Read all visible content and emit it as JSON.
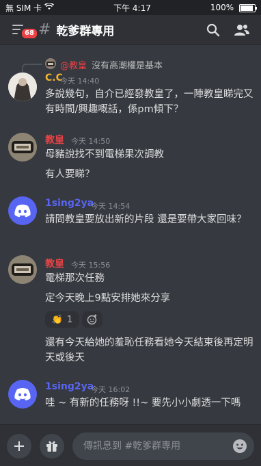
{
  "status_bar": {
    "carrier": "無 SIM 卡",
    "time": "下午 4:17",
    "battery_percent": "100%",
    "battery_level": 1.0
  },
  "header": {
    "badge_count": "68",
    "channel_name": "乾爹群專用"
  },
  "reply": {
    "mention": "@教皇",
    "text": "沒有高潮權是基本"
  },
  "messages": [
    {
      "author": "C.C",
      "author_color": "#f0b232",
      "timestamp": "今天 14:40",
      "lines": [
        "多說幾句，自介已經發教皇了，一陣教皇睇完又有時間/興趣嘅話，係pm傾下？"
      ]
    },
    {
      "author": "教皇",
      "author_color": "#ed4245",
      "timestamp": "今天 14:50",
      "lines": [
        "母豬說找不到電梯果次調教",
        "有人要睇？"
      ]
    },
    {
      "author": "1sing2ya",
      "author_color": "#5865f2",
      "timestamp": "今天 14:54",
      "lines": [
        "請問教皇要放出新的片段 還是要帶大家回味？"
      ]
    },
    {
      "author": "教皇",
      "author_color": "#ed4245",
      "timestamp": "今天 15:56",
      "lines": [
        "電梯那次任務",
        "定今天晚上9點安排她來分享",
        "還有今天給她的羞恥任務看她今天結束後再定明天或後天"
      ],
      "reaction": {
        "emoji": "👏",
        "count": "1"
      }
    },
    {
      "author": "1sing2ya",
      "author_color": "#5865f2",
      "timestamp": "今天 16:02",
      "lines": [
        "哇 ~ 有新的任務呀 !!~ 要先小小劇透一下嗎"
      ]
    }
  ],
  "composer": {
    "placeholder": "傳訊息到 #乾爹群專用"
  }
}
